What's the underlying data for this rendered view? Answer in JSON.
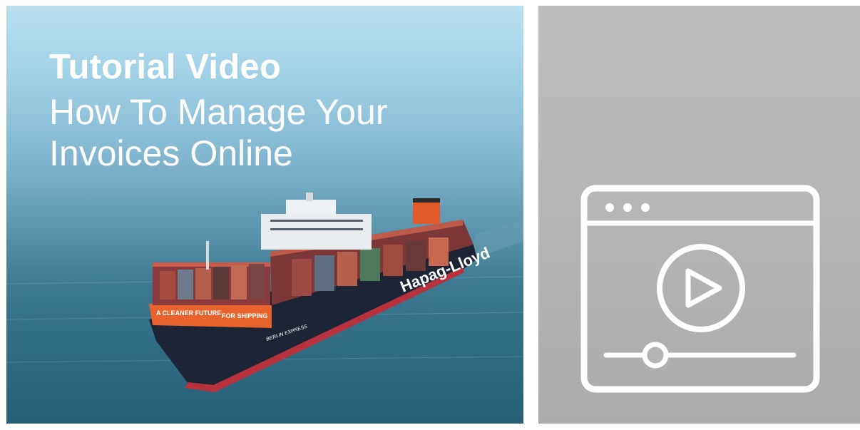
{
  "thumbnail": {
    "title_bold": "Tutorial Video",
    "title_light": "How To Manage Your Invoices Online",
    "ship_hull_text": "Hapag-Lloyd",
    "ship_bow_text_left": "A CLEANER FUTURE",
    "ship_bow_text_right": "FOR SHIPPING",
    "ship_name": "BERLIN EXPRESS"
  },
  "video_icon": {
    "name": "video-player-icon",
    "color": "#ffffff"
  },
  "colors": {
    "sky": "#b9e0f1",
    "sea": "#2f6b83",
    "hull": "#1d2534",
    "hull_stripe": "#b7323c",
    "bow_band": "#e8642c",
    "panel_grey": "#b3b3b3"
  }
}
